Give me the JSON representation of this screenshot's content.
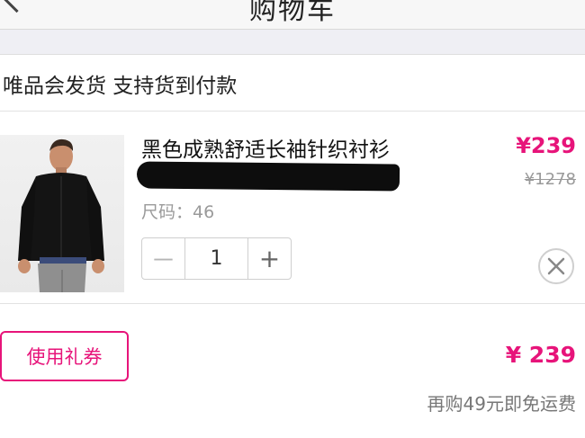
{
  "nav": {
    "title": "购物车"
  },
  "shipping": {
    "text": "唯品会发货 支持货到付款"
  },
  "product": {
    "name": "黑色成熟舒适长袖针织衬衫",
    "redacted_tail": "",
    "size": "尺码：46",
    "price": "¥239",
    "original_price": "¥1278",
    "quantity": "1",
    "minus": "－",
    "plus": "+"
  },
  "summary": {
    "coupon_label": "使用礼券",
    "total": "¥ 239",
    "shipping_note": "再购49元即免运费"
  },
  "colors": {
    "accent": "#e7147a",
    "muted": "#9a9a9a",
    "band": "#efeff4"
  },
  "icons": [
    "back-icon",
    "close-icon"
  ]
}
